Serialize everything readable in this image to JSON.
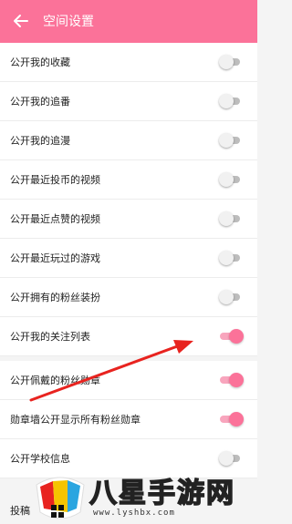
{
  "header": {
    "title": "空间设置",
    "back_icon": "arrow-left-icon"
  },
  "settings": [
    {
      "label": "公开我的收藏",
      "on": false
    },
    {
      "label": "公开我的追番",
      "on": false
    },
    {
      "label": "公开我的追漫",
      "on": false
    },
    {
      "label": "公开最近投币的视频",
      "on": false
    },
    {
      "label": "公开最近点赞的视频",
      "on": false
    },
    {
      "label": "公开最近玩过的游戏",
      "on": false
    },
    {
      "label": "公开拥有的粉丝装扮",
      "on": false
    },
    {
      "label": "公开我的关注列表",
      "on": true
    },
    {
      "label": "公开佩戴的粉丝勋章",
      "on": true
    },
    {
      "label": "勋章墙公开显示所有粉丝勋章",
      "on": true
    },
    {
      "label": "公开学校信息",
      "on": false
    }
  ],
  "bottom_section_label": "投稿",
  "colors": {
    "accent": "#fb7299",
    "toggle_off": "#bdbdbd",
    "arrow": "#e8231f"
  },
  "watermark": {
    "text": "八星手游网",
    "url": "www.lyshbx.com"
  }
}
